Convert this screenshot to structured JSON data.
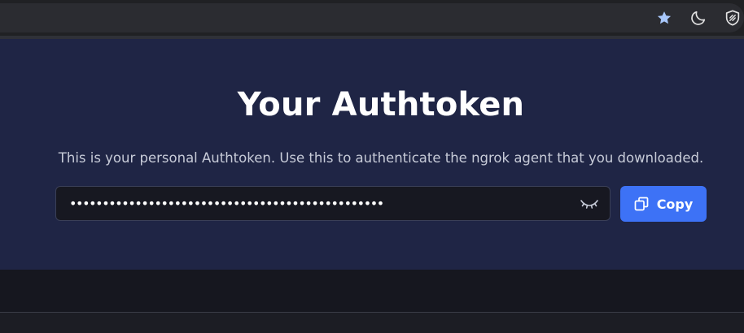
{
  "browser": {
    "icons": [
      "star-icon",
      "moon-icon",
      "shield-icon"
    ]
  },
  "hero": {
    "title": "Your Authtoken",
    "subtitle": "This is your personal Authtoken. Use this to authenticate the ngrok agent that you downloaded."
  },
  "token": {
    "masked_value": "••••••••••••••••••••••••••••••••••••••••••••••••",
    "toggle_icon": "eye-closed-icon"
  },
  "copy": {
    "label": "Copy",
    "icon": "copy-icon"
  },
  "colors": {
    "hero_background": "#1f2545",
    "page_background": "#16171f",
    "accent": "#3d72f6",
    "field_background": "#171821"
  }
}
